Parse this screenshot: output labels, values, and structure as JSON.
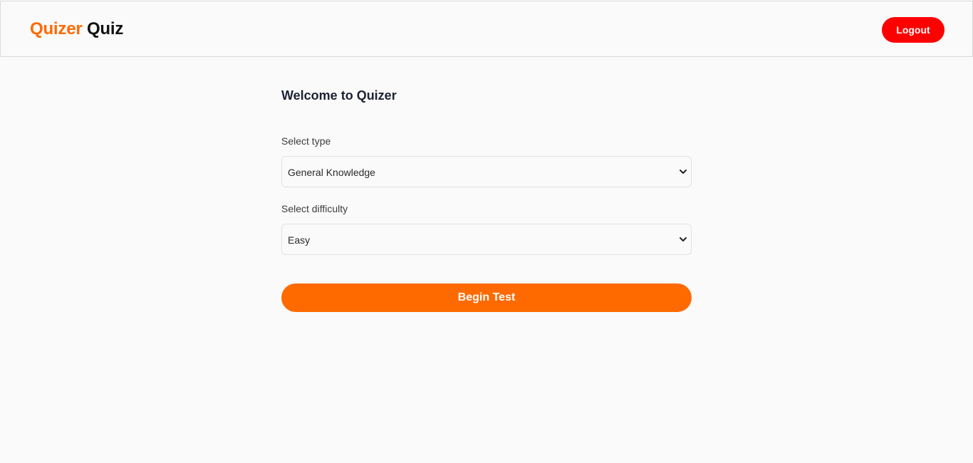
{
  "header": {
    "brand_accent": "Quizer",
    "brand_dark": "Quiz",
    "logout_label": "Logout"
  },
  "main": {
    "welcome": "Welcome to Quizer",
    "type_label": "Select type",
    "type_value": "General Knowledge",
    "difficulty_label": "Select difficulty",
    "difficulty_value": "Easy",
    "begin_label": "Begin Test"
  },
  "colors": {
    "accent": "#ff6a00",
    "logout": "#ff0000",
    "background": "#fafafa",
    "heading": "#1c2233"
  },
  "icons": {
    "select_arrow": "chevron-down-icon"
  }
}
